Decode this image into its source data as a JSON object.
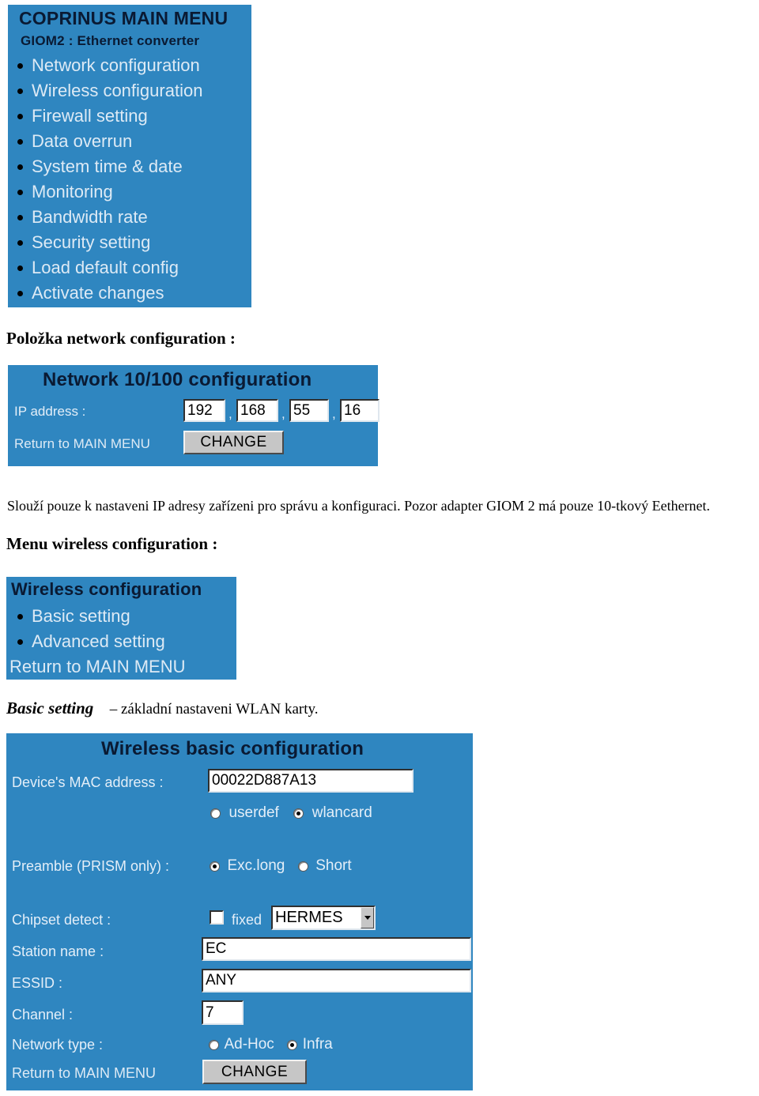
{
  "colors": {
    "panel_blue": "#2f86c0",
    "panel_title_text": "#0a1a33",
    "panel_link_text": "#ddeaf5",
    "button_face": "#c6c6c6"
  },
  "main_menu_panel": {
    "title": "COPRINUS MAIN MENU",
    "subtitle": "GIOM2 : Ethernet converter",
    "items": [
      {
        "label": "Network configuration"
      },
      {
        "label": "Wireless configuration"
      },
      {
        "label": "Firewall setting"
      },
      {
        "label": "Data overrun"
      },
      {
        "label": "System time & date"
      },
      {
        "label": "Monitoring"
      },
      {
        "label": "Bandwidth rate"
      },
      {
        "label": "Security setting"
      },
      {
        "label": "Load default config"
      },
      {
        "label": "Activate changes"
      }
    ]
  },
  "heading_network": "Položka network configuration :",
  "network_panel": {
    "title": "Network 10/100 configuration",
    "ip_label": "IP address :",
    "ip_octets": [
      "192",
      "168",
      "55",
      "16"
    ],
    "separator": ",",
    "return_link": "Return to MAIN MENU",
    "change_button": "CHANGE"
  },
  "paragraph_network": "Slouží pouze k nastaveni IP adresy zařízeni pro správu a konfiguraci. Pozor adapter GIOM 2 má pouze 10-tkový Eethernet.",
  "heading_wireless": "Menu wireless configuration :",
  "wireless_menu_panel": {
    "title": "Wireless configuration",
    "items": [
      {
        "label": "Basic setting"
      },
      {
        "label": "Advanced setting"
      }
    ],
    "return_link": "Return to MAIN MENU"
  },
  "basic_setting_note": {
    "term": "Basic setting",
    "description": "– základní nastaveni WLAN karty."
  },
  "wireless_basic_panel": {
    "title": "Wireless basic configuration",
    "mac_label": "Device's MAC address :",
    "mac_value": "00022D887A13",
    "mac_source": {
      "options": [
        "userdef",
        "wlancard"
      ],
      "selected": "wlancard"
    },
    "preamble_label": "Preamble (PRISM only) :",
    "preamble": {
      "options": [
        "Exc.long",
        "Short"
      ],
      "selected": "Exc.long"
    },
    "chipset_label": "Chipset detect :",
    "chipset_fixed_label": "fixed",
    "chipset_fixed_checked": false,
    "chipset_value": "HERMES",
    "station_label": "Station name :",
    "station_value": "EC",
    "essid_label": "ESSID :",
    "essid_value": "ANY",
    "channel_label": "Channel :",
    "channel_value": "7",
    "network_type_label": "Network type :",
    "network_type": {
      "options": [
        "Ad-Hoc",
        "Infra"
      ],
      "selected": "Infra"
    },
    "return_link": "Return to MAIN MENU",
    "change_button": "CHANGE"
  }
}
